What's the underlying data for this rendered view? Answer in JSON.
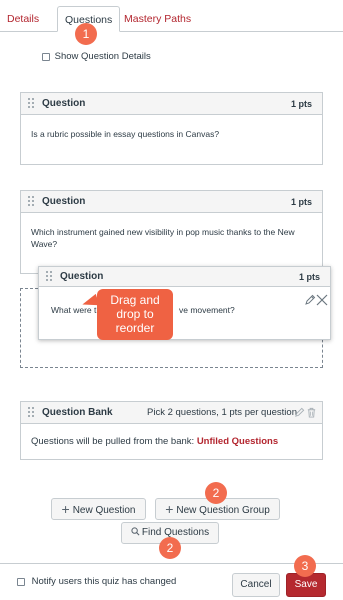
{
  "tabs": {
    "details": "Details",
    "questions": "Questions",
    "mastery": "Mastery Paths"
  },
  "show_details": {
    "label": "Show Question Details"
  },
  "questions": [
    {
      "title": "Question",
      "pts": "1 pts",
      "text": "Is a rubric possible in essay questions in Canvas?"
    },
    {
      "title": "Question",
      "pts": "1 pts",
      "text_line1": "Which instrument gained new visibility in pop music thanks to the New",
      "text_line2": "Wave?"
    }
  ],
  "dragging": {
    "title": "Question",
    "pts": "1 pts",
    "text_left": "What were th",
    "text_right": "ve movement?"
  },
  "callout": {
    "line1": "Drag and",
    "line2": "drop to",
    "line3": "reorder"
  },
  "bank": {
    "title": "Question Bank",
    "summary": "Pick 2 questions, 1 pts per question",
    "pulled_text": "Questions will be pulled from the bank: ",
    "bank_name": "Unfiled Questions"
  },
  "actions": {
    "new_question": "New Question",
    "new_group": "New Question Group",
    "find_questions": "Find Questions"
  },
  "footer": {
    "notify_label": "Notify users this quiz has changed",
    "cancel": "Cancel",
    "save": "Save"
  },
  "badges": {
    "tab_step": "1",
    "group_step": "2",
    "find_step": "2",
    "save_step": "3"
  },
  "colors": {
    "accent_red": "#b3262f",
    "badge_orange": "#f26c4f",
    "save_red": "#b5292f"
  }
}
